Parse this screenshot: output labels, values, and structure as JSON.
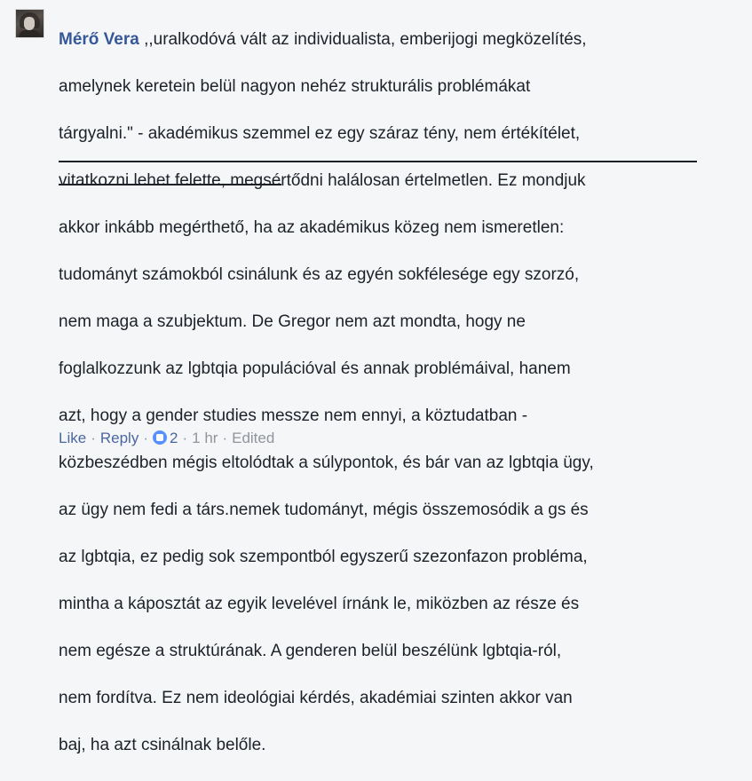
{
  "comment": {
    "author": "Mérő Vera",
    "lines": [
      ",,uralkodóvá vált az individualista, emberijogi megközelítés,",
      "amelynek keretein belül nagyon nehéz strukturális problémákat",
      "tárgyalni.\" - akadémikus szemmel ez egy száraz tény, nem értékítélet,",
      "vitatkozni lehet felette, megsértődni halálosan értelmetlen. Ez mondjuk",
      "akkor inkább megérthető, ha az akadémikus közeg nem ismeretlen:",
      "tudományt számokból csinálunk és az egyén sokfélesége egy szorzó,",
      "nem maga a szubjektum.",
      " De Gregor nem azt mondta, hogy ne",
      "foglalkozzunk az lgbtqia populációval és annak problémáival, hanem",
      "azt, hogy a gender studies messze nem ennyi, a köztudatban -",
      "közbeszédben mégis eltolódtak a súlypontok, és bár van az lgbtqia ügy,",
      "az ügy nem fedi a társ.nemek tudományt, mégis összemosódik a gs és",
      "az lgbtqia, ez pedig sok szempontból egyszerű szezonfazon probléma,",
      "mintha a káposztát az egyik levelével írnánk le, miközben az része és",
      "nem egésze a struktúrának. A genderen belül beszélünk lgbtqia-ról,",
      "nem fordítva. Ez nem ideológiai kérdés, akadémiai szinten akkor van",
      "baj, ha azt csinálnak belőle."
    ],
    "actions": {
      "like": "Like",
      "separator": "·",
      "reply": "Reply",
      "reaction_count": "2",
      "time": "1 hr",
      "edited": "Edited"
    }
  },
  "icons": {
    "avatar": "profile-photo",
    "reaction": "like-reaction-icon"
  },
  "colors": {
    "background": "#f5f6f7",
    "author": "#365899",
    "text": "#1d2129",
    "link": "#4b67a1",
    "meta": "#90949c",
    "reaction": "#5890ff"
  }
}
